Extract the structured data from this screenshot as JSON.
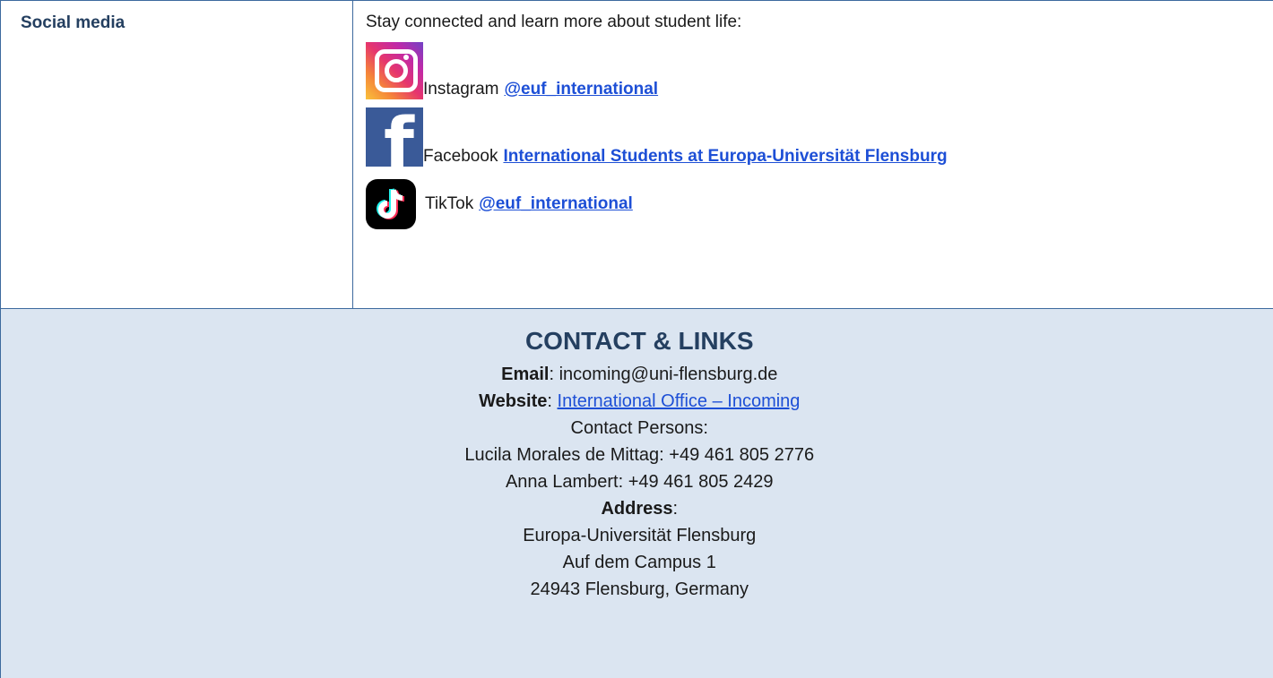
{
  "social": {
    "label": "Social media",
    "intro": "Stay connected and learn more about student life:",
    "instagram": {
      "icon": "instagram-icon",
      "name": "Instagram",
      "handle": "@euf_international"
    },
    "facebook": {
      "icon": "facebook-icon",
      "name": "Facebook",
      "link": "International Students at Europa-Universität Flensburg"
    },
    "tiktok": {
      "icon": "tiktok-icon",
      "name": "TikTok",
      "handle": "@euf_international"
    }
  },
  "contact": {
    "title": "CONTACT & LINKS",
    "email_label": "Email",
    "email_value": ": incoming@uni-flensburg.de",
    "website_label": "Website",
    "website_sep": ": ",
    "website_link": "International Office – Incoming",
    "persons_heading": "Contact Persons:",
    "person1": "Lucila Morales de Mittag: +49 461 805 2776",
    "person2": "Anna Lambert: +49 461 805 2429",
    "address_label": "Address",
    "address_sep": ":",
    "address_lines": [
      "Europa-Universität Flensburg",
      "Auf dem Campus 1",
      "24943 Flensburg, Germany"
    ]
  },
  "colors": {
    "heading": "#243f60",
    "border": "#3d6a9e",
    "contact_bg": "#dbe5f1",
    "link": "#1d4fd6",
    "facebook": "#3a5a98"
  }
}
